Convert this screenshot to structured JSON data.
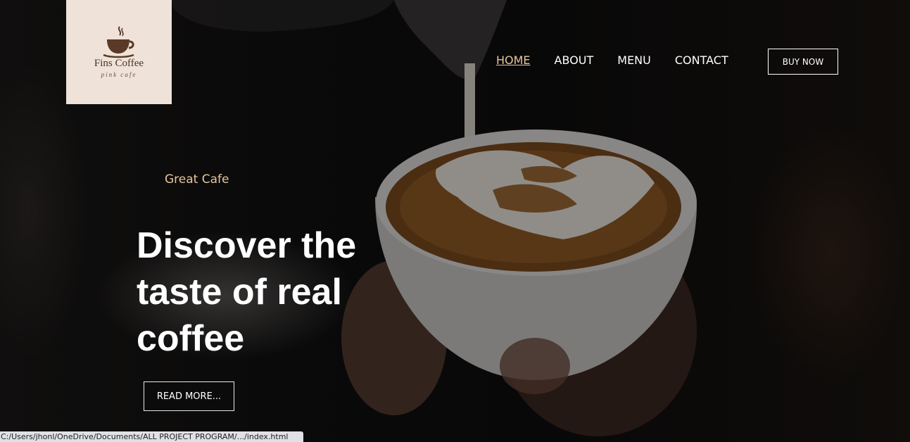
{
  "logo": {
    "name": "Fins Coffee",
    "tagline": "pink cafe"
  },
  "nav": {
    "items": [
      {
        "label": "HOME",
        "active": true
      },
      {
        "label": "ABOUT",
        "active": false
      },
      {
        "label": "MENU",
        "active": false
      },
      {
        "label": "CONTACT",
        "active": false
      }
    ],
    "buy_label": "BUY NOW"
  },
  "hero": {
    "eyebrow": "Great Cafe",
    "headline_lines": [
      "Discover the",
      "taste of real",
      "coffee"
    ],
    "read_more_label": "READ MORE..."
  },
  "status_bar": {
    "url": "C:/Users/jhonl/OneDrive/Documents/ALL PROJECT PROGRAM/.../index.html"
  },
  "colors": {
    "accent": "#e8c59c",
    "logo_background": "#efe2d8",
    "text": "#ffffff"
  },
  "icons": {
    "logo_icon": "coffee-cup-icon"
  }
}
